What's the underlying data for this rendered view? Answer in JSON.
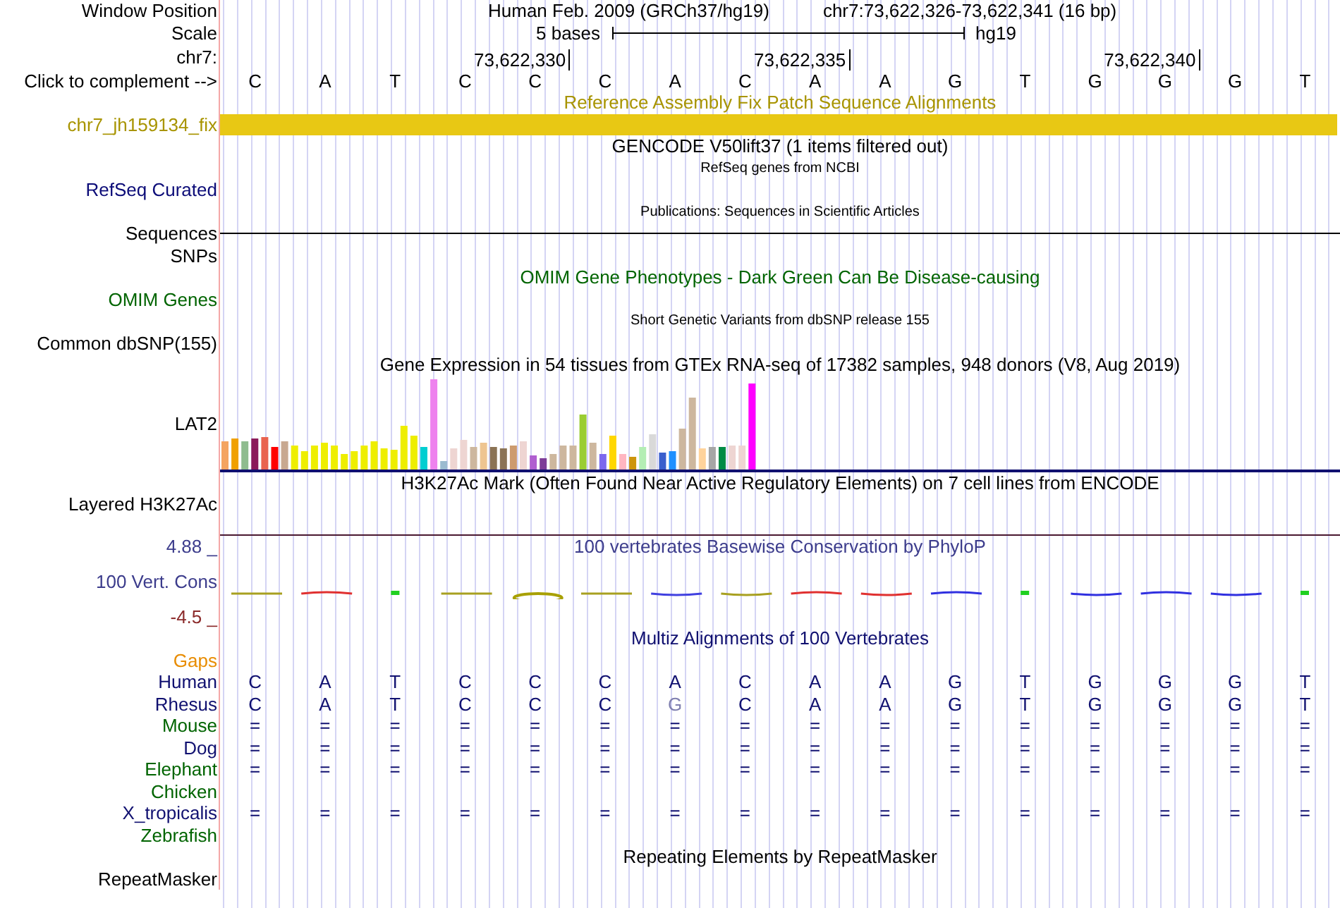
{
  "header": {
    "position_label": "Window Position",
    "assembly": "Human Feb. 2009 (GRCh37/hg19)",
    "position": "chr7:73,622,326-73,622,341 (16 bp)",
    "scale_label": "Scale",
    "scale_span": "5 bases",
    "scale_assembly": "hg19",
    "chrom_label": "chr7:",
    "complement_label": "Click to complement -->"
  },
  "bases": [
    {
      "letter": "C"
    },
    {
      "letter": "A"
    },
    {
      "letter": "T"
    },
    {
      "letter": "C"
    },
    {
      "letter": "C",
      "tick": "73,622,330"
    },
    {
      "letter": "C"
    },
    {
      "letter": "A"
    },
    {
      "letter": "C"
    },
    {
      "letter": "A",
      "tick": "73,622,335"
    },
    {
      "letter": "A"
    },
    {
      "letter": "G"
    },
    {
      "letter": "T"
    },
    {
      "letter": "G"
    },
    {
      "letter": "G",
      "tick": "73,622,340"
    },
    {
      "letter": "G"
    },
    {
      "letter": "T"
    }
  ],
  "tracks": [
    {
      "kind": "title",
      "title": "Reference Assembly Fix Patch Sequence Alignments",
      "color": "#a89400"
    },
    {
      "kind": "feature",
      "label": "chr7_jh159134_fix",
      "color": "#a89400"
    },
    {
      "kind": "title",
      "title": "GENCODE V50lift37 (1 items filtered out)",
      "color": "#000000"
    },
    {
      "kind": "note",
      "title": "RefSeq genes from NCBI",
      "color": "#000000"
    },
    {
      "kind": "plain",
      "label": "RefSeq Curated",
      "color": "#0c0c78"
    },
    {
      "kind": "note",
      "title": "Publications: Sequences in Scientific Articles",
      "color": "#000000"
    },
    {
      "kind": "rule",
      "label": "Sequences",
      "color": "#000000"
    },
    {
      "kind": "plain",
      "label": "SNPs",
      "color": "#000000"
    },
    {
      "kind": "title",
      "title": "OMIM Gene Phenotypes - Dark Green Can Be Disease-causing",
      "color": "#006400"
    },
    {
      "kind": "plain",
      "label": "OMIM Genes",
      "color": "#006400"
    },
    {
      "kind": "note",
      "title": "Short Genetic Variants from dbSNP release 155",
      "color": "#000000"
    },
    {
      "kind": "plain",
      "label": "Common dbSNP(155)",
      "color": "#000000"
    },
    {
      "kind": "title",
      "title": "Gene Expression in 54 tissues from GTEx RNA-seq of 17382 samples, 948 donors (V8, Aug 2019)",
      "color": "#000000"
    },
    {
      "kind": "chart",
      "label": "LAT2",
      "color": "#000000"
    },
    {
      "kind": "title",
      "title": "H3K27Ac Mark (Often Found Near Active Regulatory Elements) on 7 cell lines from ENCODE",
      "color": "#000000"
    },
    {
      "kind": "plain",
      "label": "Layered H3K27Ac",
      "color": "#000000"
    },
    {
      "kind": "divider",
      "color": "#4a1830"
    },
    {
      "kind": "plain",
      "label": "4.88 _",
      "title": "100 vertebrates Basewise Conservation by PhyloP",
      "color": "#3c3c8c"
    },
    {
      "kind": "wiggle",
      "label": "100 Vert. Cons",
      "color": "#3c3c8c"
    },
    {
      "kind": "plain",
      "label": "-4.5 _",
      "color": "#8b2a2a"
    },
    {
      "kind": "title",
      "title": "Multiz Alignments of 100 Vertebrates",
      "color": "#101070"
    },
    {
      "kind": "plain",
      "label": "Gaps",
      "color": "#e88c00"
    },
    {
      "kind": "bases",
      "label": "Human",
      "color": "#101070",
      "letters": [
        {
          "letter": "C",
          "faded": false
        },
        {
          "letter": "A",
          "faded": false
        },
        {
          "letter": "T",
          "faded": false
        },
        {
          "letter": "C",
          "faded": false
        },
        {
          "letter": "C",
          "faded": false
        },
        {
          "letter": "C",
          "faded": false
        },
        {
          "letter": "A",
          "faded": false
        },
        {
          "letter": "C",
          "faded": false
        },
        {
          "letter": "A",
          "faded": false
        },
        {
          "letter": "A",
          "faded": false
        },
        {
          "letter": "G",
          "faded": false
        },
        {
          "letter": "T",
          "faded": false
        },
        {
          "letter": "G",
          "faded": false
        },
        {
          "letter": "G",
          "faded": false
        },
        {
          "letter": "G",
          "faded": false
        },
        {
          "letter": "T",
          "faded": false
        }
      ]
    },
    {
      "kind": "bases",
      "label": "Rhesus",
      "color": "#101070",
      "letters": [
        {
          "letter": "C",
          "faded": false
        },
        {
          "letter": "A",
          "faded": false
        },
        {
          "letter": "T",
          "faded": false
        },
        {
          "letter": "C",
          "faded": false
        },
        {
          "letter": "C",
          "faded": false
        },
        {
          "letter": "C",
          "faded": false
        },
        {
          "letter": "G",
          "faded": true
        },
        {
          "letter": "C",
          "faded": false
        },
        {
          "letter": "A",
          "faded": false
        },
        {
          "letter": "A",
          "faded": false
        },
        {
          "letter": "G",
          "faded": false
        },
        {
          "letter": "T",
          "faded": false
        },
        {
          "letter": "G",
          "faded": false
        },
        {
          "letter": "G",
          "faded": false
        },
        {
          "letter": "G",
          "faded": false
        },
        {
          "letter": "T",
          "faded": false
        }
      ]
    },
    {
      "kind": "bases",
      "label": "Mouse",
      "color": "#006400",
      "letters": [
        {
          "letter": "=",
          "faded": false
        },
        {
          "letter": "=",
          "faded": false
        },
        {
          "letter": "=",
          "faded": false
        },
        {
          "letter": "=",
          "faded": false
        },
        {
          "letter": "=",
          "faded": false
        },
        {
          "letter": "=",
          "faded": false
        },
        {
          "letter": "=",
          "faded": false
        },
        {
          "letter": "=",
          "faded": false
        },
        {
          "letter": "=",
          "faded": false
        },
        {
          "letter": "=",
          "faded": false
        },
        {
          "letter": "=",
          "faded": false
        },
        {
          "letter": "=",
          "faded": false
        },
        {
          "letter": "=",
          "faded": false
        },
        {
          "letter": "=",
          "faded": false
        },
        {
          "letter": "=",
          "faded": false
        },
        {
          "letter": "=",
          "faded": false
        }
      ]
    },
    {
      "kind": "bases",
      "label": "Dog",
      "color": "#101070",
      "letters": [
        {
          "letter": "=",
          "faded": false
        },
        {
          "letter": "=",
          "faded": false
        },
        {
          "letter": "=",
          "faded": false
        },
        {
          "letter": "=",
          "faded": false
        },
        {
          "letter": "=",
          "faded": false
        },
        {
          "letter": "=",
          "faded": false
        },
        {
          "letter": "=",
          "faded": false
        },
        {
          "letter": "=",
          "faded": false
        },
        {
          "letter": "=",
          "faded": false
        },
        {
          "letter": "=",
          "faded": false
        },
        {
          "letter": "=",
          "faded": false
        },
        {
          "letter": "=",
          "faded": false
        },
        {
          "letter": "=",
          "faded": false
        },
        {
          "letter": "=",
          "faded": false
        },
        {
          "letter": "=",
          "faded": false
        },
        {
          "letter": "=",
          "faded": false
        }
      ]
    },
    {
      "kind": "bases",
      "label": "Elephant",
      "color": "#006400",
      "letters": [
        {
          "letter": "=",
          "faded": false
        },
        {
          "letter": "=",
          "faded": false
        },
        {
          "letter": "=",
          "faded": false
        },
        {
          "letter": "=",
          "faded": false
        },
        {
          "letter": "=",
          "faded": false
        },
        {
          "letter": "=",
          "faded": false
        },
        {
          "letter": "=",
          "faded": false
        },
        {
          "letter": "=",
          "faded": false
        },
        {
          "letter": "=",
          "faded": false
        },
        {
          "letter": "=",
          "faded": false
        },
        {
          "letter": "=",
          "faded": false
        },
        {
          "letter": "=",
          "faded": false
        },
        {
          "letter": "=",
          "faded": false
        },
        {
          "letter": "=",
          "faded": false
        },
        {
          "letter": "=",
          "faded": false
        },
        {
          "letter": "=",
          "faded": false
        }
      ]
    },
    {
      "kind": "plain",
      "label": "Chicken",
      "color": "#006400"
    },
    {
      "kind": "bases",
      "label": "X_tropicalis",
      "color": "#101070",
      "letters": [
        {
          "letter": "=",
          "faded": false
        },
        {
          "letter": "=",
          "faded": false
        },
        {
          "letter": "=",
          "faded": false
        },
        {
          "letter": "=",
          "faded": false
        },
        {
          "letter": "=",
          "faded": false
        },
        {
          "letter": "=",
          "faded": false
        },
        {
          "letter": "=",
          "faded": false
        },
        {
          "letter": "=",
          "faded": false
        },
        {
          "letter": "=",
          "faded": false
        },
        {
          "letter": "=",
          "faded": false
        },
        {
          "letter": "=",
          "faded": false
        },
        {
          "letter": "=",
          "faded": false
        },
        {
          "letter": "=",
          "faded": false
        },
        {
          "letter": "=",
          "faded": false
        },
        {
          "letter": "=",
          "faded": false
        },
        {
          "letter": "=",
          "faded": false
        }
      ]
    },
    {
      "kind": "plain",
      "label": "Zebrafish",
      "color": "#006400"
    },
    {
      "kind": "title",
      "title": "Repeating Elements by RepeatMasker",
      "color": "#000000"
    },
    {
      "kind": "plain",
      "label": "RepeatMasker",
      "color": "#000000"
    }
  ]
}
